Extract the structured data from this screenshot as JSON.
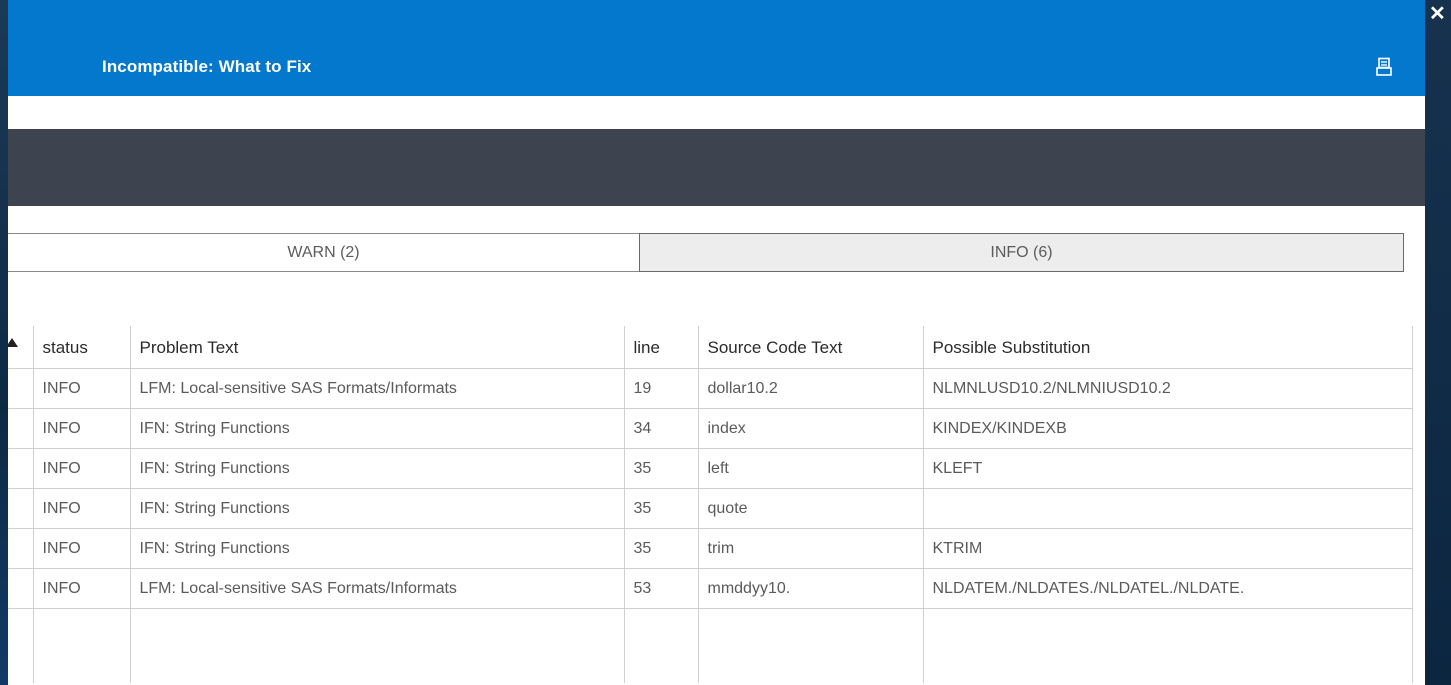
{
  "dialog": {
    "title": "Incompatible: What to Fix",
    "close_glyph": "✕",
    "icons": {
      "close": "close-icon",
      "print": "print-icon",
      "sort": "sort-ascending-icon"
    }
  },
  "tabs": [
    {
      "label": "WARN (2)",
      "selected": false
    },
    {
      "label": "INFO (6)",
      "selected": true
    }
  ],
  "table": {
    "columns": [
      "status",
      "Problem Text",
      "line",
      "Source Code Text",
      "Possible Substitution"
    ],
    "sorted_column": "status",
    "rows": [
      [
        "INFO",
        "LFM: Local-sensitive SAS Formats/Informats",
        "19",
        "dollar10.2",
        "NLMNLUSD10.2/NLMNIUSD10.2"
      ],
      [
        "INFO",
        "IFN: String Functions",
        "34",
        "index",
        "KINDEX/KINDEXB"
      ],
      [
        "INFO",
        "IFN: String Functions",
        "35",
        "left",
        "KLEFT"
      ],
      [
        "INFO",
        "IFN: String Functions",
        "35",
        "quote",
        ""
      ],
      [
        "INFO",
        "IFN: String Functions",
        "35",
        "trim",
        "KTRIM"
      ],
      [
        "INFO",
        "LFM: Local-sensitive SAS Formats/Informats",
        "53",
        "mmddyy10.",
        "NLDATEM./NLDATES./NLDATEL./NLDATE."
      ]
    ]
  },
  "colors": {
    "titlebar": "#0378cd",
    "band": "#3d4450",
    "tab_selected": "#ededed"
  }
}
